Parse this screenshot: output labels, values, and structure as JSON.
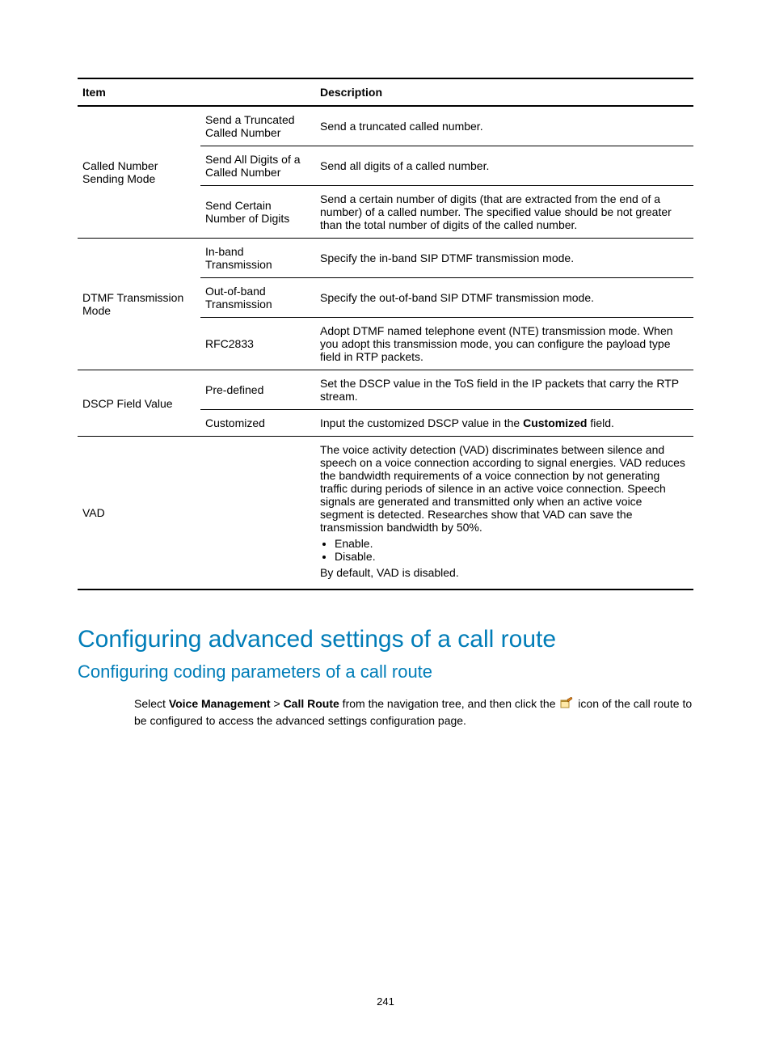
{
  "table": {
    "header": {
      "item": "Item",
      "desc": "Description"
    },
    "groups": [
      {
        "item": "Called Number Sending Mode",
        "rows": [
          {
            "param": "Send a Truncated Called Number",
            "desc": "Send a truncated called number."
          },
          {
            "param": "Send All Digits of a Called Number",
            "desc": "Send all digits of a called number."
          },
          {
            "param": "Send Certain Number of Digits",
            "desc": "Send a certain number of digits (that are extracted from the end of a number) of a called number. The specified value should be not greater than the total number of digits of the called number."
          }
        ]
      },
      {
        "item": "DTMF Transmission Mode",
        "rows": [
          {
            "param": "In-band Transmission",
            "desc": "Specify the in-band SIP DTMF transmission mode."
          },
          {
            "param": "Out-of-band Transmission",
            "desc": "Specify the out-of-band SIP DTMF transmission mode."
          },
          {
            "param": "RFC2833",
            "desc": "Adopt DTMF named telephone event (NTE) transmission mode. When you adopt this transmission mode, you can configure the payload type field in RTP packets."
          }
        ]
      },
      {
        "item": "DSCP Field Value",
        "rows": [
          {
            "param": "Pre-defined",
            "desc": "Set the DSCP value in the ToS field in the IP packets that carry the RTP stream."
          },
          {
            "param": "Customized",
            "desc_pre": "Input the customized DSCP value in the ",
            "desc_bold": "Customized",
            "desc_post": " field."
          }
        ]
      },
      {
        "item": "VAD",
        "single": {
          "para": "The voice activity detection (VAD) discriminates between silence and speech on a voice connection according to signal energies. VAD reduces the bandwidth requirements of a voice connection by not generating traffic during periods of silence in an active voice connection. Speech signals are generated and transmitted only when an active voice segment is detected. Researches show that VAD can save the transmission bandwidth by 50%.",
          "bullets": [
            "Enable.",
            "Disable."
          ],
          "trailer": "By default, VAD is disabled."
        }
      }
    ]
  },
  "heading1": "Configuring advanced settings of a call route",
  "heading2": "Configuring coding parameters of a call route",
  "body": {
    "pre": "Select ",
    "b1": "Voice Management",
    "gt": " > ",
    "b2": "Call Route",
    "mid": " from the navigation tree, and then click the ",
    "post": " icon of the call route to be configured to access the advanced settings configuration page."
  },
  "pagenum": "241"
}
